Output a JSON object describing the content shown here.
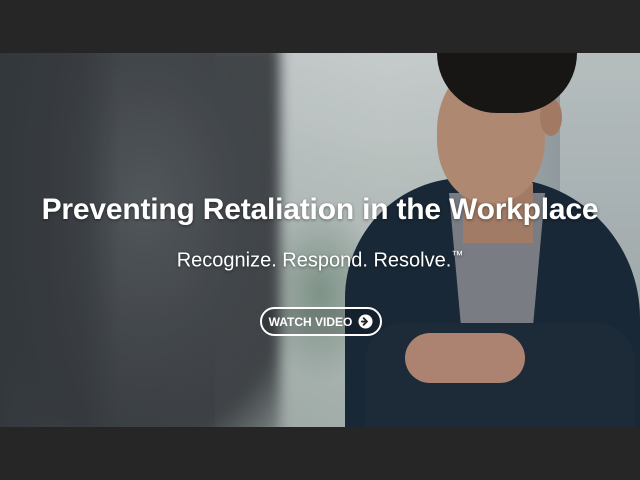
{
  "hero": {
    "headline": "Preventing Retaliation in the Workplace",
    "tagline": "Recognize. Respond. Resolve.",
    "trademark": "™",
    "cta_label": "WATCH VIDEO",
    "cta_icon": "arrow-circle-right-icon"
  },
  "colors": {
    "frame": "#262626",
    "text": "#ffffff"
  }
}
